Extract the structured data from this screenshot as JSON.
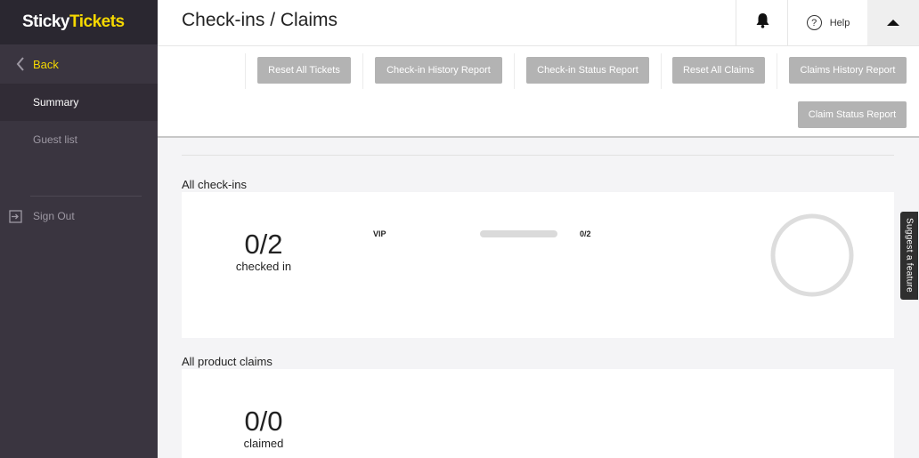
{
  "brand": {
    "part1": "Sticky",
    "part2": "Tickets"
  },
  "sidebar": {
    "back_label": "Back",
    "items": [
      {
        "label": "Summary",
        "active": true
      },
      {
        "label": "Guest list",
        "active": false
      }
    ],
    "signout_label": "Sign Out"
  },
  "header": {
    "title": "Check-ins / Claims",
    "help_label": "Help"
  },
  "toolbar": {
    "buttons": [
      "Reset All Tickets",
      "Check-in History Report",
      "Check-in Status Report",
      "Reset All Claims",
      "Claims History Report",
      "Claim Status Report"
    ]
  },
  "checkins": {
    "section_title": "All check-ins",
    "count": "0/2",
    "count_label": "checked in",
    "ticket_type": "VIP",
    "ticket_count": "0/2",
    "progress_fraction": 0,
    "ring_color": "#dddddd"
  },
  "claims": {
    "section_title": "All product claims",
    "count": "0/0",
    "count_label": "claimed"
  },
  "suggest_label": "Suggest a feature",
  "colors": {
    "brand_yellow": "#f5d800",
    "sidebar_bg": "#3a3540",
    "button_gray": "#b3b3b3"
  }
}
